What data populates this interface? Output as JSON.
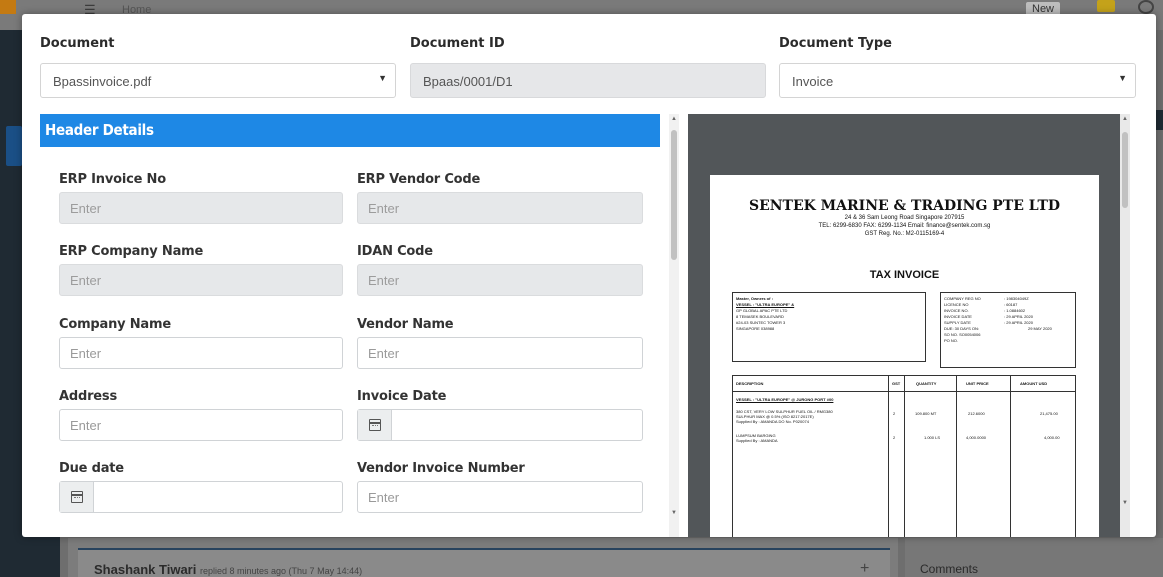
{
  "background": {
    "breadcrumb": "Home",
    "new_label": "New",
    "feed_author": "Shashank Tiwari",
    "feed_meta": "replied 8 minutes ago (Thu 7 May 14:44)",
    "comments_label": "Comments"
  },
  "top": {
    "document_label": "Document",
    "document_value": "Bpassinvoice.pdf",
    "document_id_label": "Document ID",
    "document_id_value": "Bpaas/0001/D1",
    "document_type_label": "Document Type",
    "document_type_value": "Invoice"
  },
  "header_details": {
    "title": "Header Details",
    "fields": {
      "erp_invoice_no": {
        "label": "ERP Invoice No",
        "placeholder": "Enter"
      },
      "erp_vendor_code": {
        "label": "ERP Vendor Code",
        "placeholder": "Enter"
      },
      "erp_company_name": {
        "label": "ERP Company Name",
        "placeholder": "Enter"
      },
      "idan_code": {
        "label": "IDAN Code",
        "placeholder": "Enter"
      },
      "company_name": {
        "label": "Company Name",
        "placeholder": "Enter"
      },
      "vendor_name": {
        "label": "Vendor Name",
        "placeholder": "Enter"
      },
      "address": {
        "label": "Address",
        "placeholder": "Enter"
      },
      "invoice_date": {
        "label": "Invoice Date",
        "value": ""
      },
      "due_date": {
        "label": "Due date",
        "value": ""
      },
      "vendor_invoice_number": {
        "label": "Vendor Invoice Number",
        "placeholder": "Enter"
      }
    }
  },
  "preview": {
    "company": "SENTEK MARINE & TRADING PTE LTD",
    "address": "24 & 36 Sam Leong Road Singapore 207915",
    "contact": "TEL: 6299-6830  FAX: 6299-1134  Email: finance@sentek.com.sg",
    "gst": "GST Reg. No.: M2-0115169-4",
    "title": "TAX INVOICE",
    "bill_to": [
      "Master, Owners of :",
      "VESSEL : \"ULTRA EUROPE\" &",
      "GP GLOBAL APAC PTE LTD",
      "8 TEMASEK BOULEVARD",
      "#24-03 SUNTEC TOWER 3",
      "SINGAPORE 038988"
    ],
    "meta_labels": [
      "COMPANY REG NO",
      "LICENCE NO",
      "INVOICE NO.",
      "INVOICE DATE",
      "SUPPLY DATE",
      "DUE:   30 DAYS   ON:",
      "SO NO.   SO0054006",
      "PO NO."
    ],
    "meta_values": [
      ": 198304049Z",
      ": 60187",
      ": 1.0884602",
      ": 29 APRIL 2020",
      ": 29 APRIL 2020",
      "29 MAY 2020",
      "",
      ""
    ],
    "columns": [
      "DESCRIPTION",
      "GST",
      "QUANTITY",
      "UNIT PRICE",
      "AMOUNT  USD"
    ],
    "vessel_line": "VESSEL : \"ULTRA EUROPE\" @ JURONG PORT #00",
    "item1_desc": [
      "380 CST, VERY LOW SULPHUR FUEL OIL / RMG380",
      "SULPHUR MAX @ 0.5% (ISO 8217:2017E)",
      "Supplied By : AMANDA      DO No.  P020074"
    ],
    "item1_gst": "2",
    "item1_qty": "109.800  MT",
    "item1_price": "212.6000",
    "item1_amount": "21,475.00",
    "item2_desc": [
      "LUMPSUM BARGING",
      "Supplied By : AMANDA"
    ],
    "item2_gst": "2",
    "item2_qty": "1.000  LS",
    "item2_price": "4,000.0000",
    "item2_amount": "4,000.00"
  },
  "colors": {
    "accent": "#1e88e5",
    "disabled_bg": "#e6e8ea",
    "preview_bg": "#525659"
  }
}
